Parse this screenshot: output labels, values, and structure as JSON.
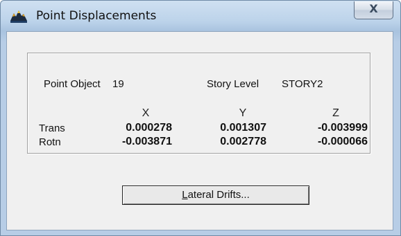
{
  "window": {
    "title": "Point Displacements",
    "close_label": "X"
  },
  "point": {
    "object_label": "Point Object",
    "object_value": "19",
    "story_label": "Story Level",
    "story_value": "STORY2"
  },
  "table": {
    "headers": [
      "X",
      "Y",
      "Z"
    ],
    "rows": [
      {
        "label": "Trans",
        "values": [
          "0.000278",
          "0.001307",
          "-0.003999"
        ]
      },
      {
        "label": "Rotn",
        "values": [
          "-0.003871",
          "0.002778",
          "-0.000066"
        ]
      }
    ]
  },
  "button": {
    "label_underlined": "L",
    "label_rest": "ateral Drifts..."
  },
  "icons": {
    "app": "mountain-app-icon",
    "close": "close-icon"
  }
}
